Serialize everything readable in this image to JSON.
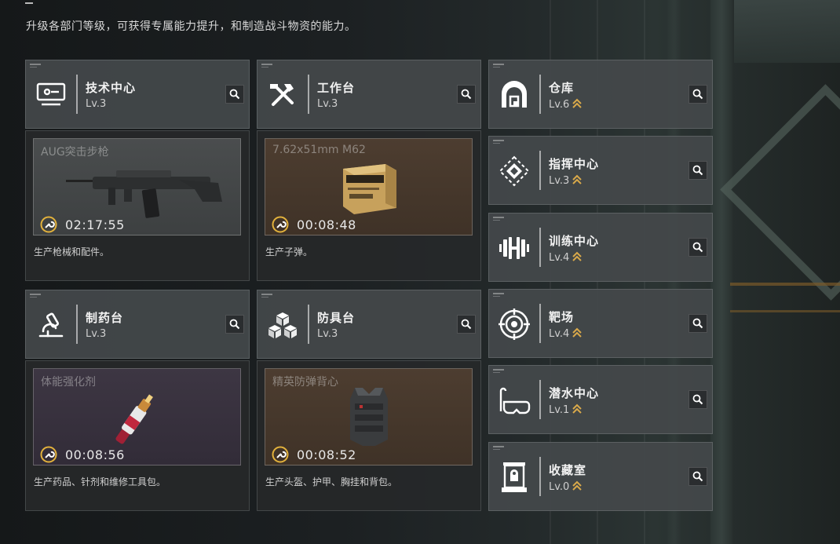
{
  "header": {
    "subtitle": "升级各部门等级，可获得专属能力提升，和制造战斗物资的能力。"
  },
  "colors": {
    "accent_gold": "#d9a94a",
    "timer_gold": "#e3b23c"
  },
  "production_departments": [
    {
      "name": "技术中心",
      "level": "Lv.3",
      "icon": "computer-icon",
      "item": "AUG突击步枪",
      "timer": "02:17:55",
      "description": "生产枪械和配件。",
      "item_icon": "assault-rifle"
    },
    {
      "name": "工作台",
      "level": "Lv.3",
      "icon": "tools-icon",
      "item": "7.62x51mm M62",
      "timer": "00:08:48",
      "description": "生产子弹。",
      "item_icon": "ammo-box"
    },
    {
      "name": "制药台",
      "level": "Lv.3",
      "icon": "microscope-icon",
      "item": "体能强化剂",
      "timer": "00:08:56",
      "description": "生产药品、针剂和维修工具包。",
      "item_icon": "injector"
    },
    {
      "name": "防具台",
      "level": "Lv.3",
      "icon": "blocks-icon",
      "item": "精英防弹背心",
      "timer": "00:08:52",
      "description": "生产头盔、护甲、胸挂和背包。",
      "item_icon": "armor-vest"
    }
  ],
  "facility_departments": [
    {
      "name": "仓库",
      "level": "Lv.6",
      "icon": "warehouse-icon",
      "upgradable": true
    },
    {
      "name": "指挥中心",
      "level": "Lv.3",
      "icon": "command-icon",
      "upgradable": true
    },
    {
      "name": "训练中心",
      "level": "Lv.4",
      "icon": "dumbbell-icon",
      "upgradable": true
    },
    {
      "name": "靶场",
      "level": "Lv.4",
      "icon": "target-icon",
      "upgradable": true
    },
    {
      "name": "潜水中心",
      "level": "Lv.1",
      "icon": "diving-goggles-icon",
      "upgradable": true
    },
    {
      "name": "收藏室",
      "level": "Lv.0",
      "icon": "display-case-icon",
      "upgradable": true
    }
  ]
}
